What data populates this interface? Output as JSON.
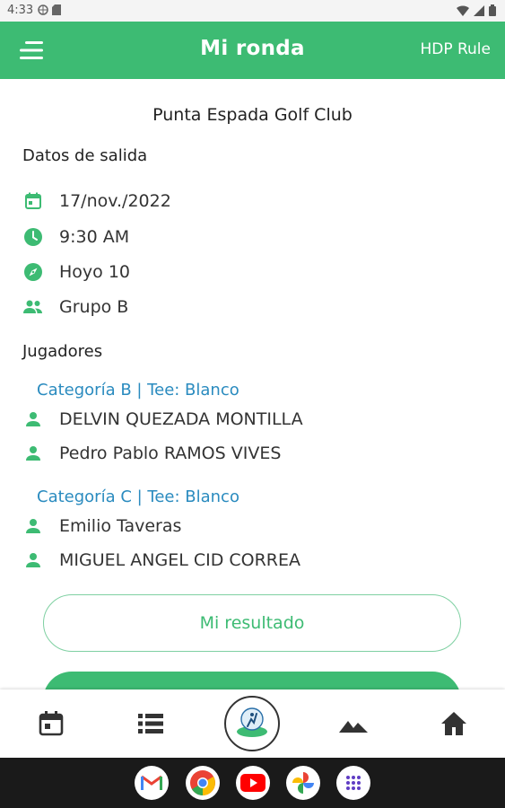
{
  "status_bar": {
    "time": "4:33"
  },
  "app_bar": {
    "title": "Mi ronda",
    "action_label": "HDP Rule"
  },
  "club_name": "Punta Espada Golf Club",
  "salida": {
    "section_title": "Datos de salida",
    "fecha": "17/nov./2022",
    "hora": "9:30 AM",
    "hoyo": "Hoyo 10",
    "grupo": "Grupo B"
  },
  "jugadores": {
    "section_title": "Jugadores",
    "groups": [
      {
        "category": "Categoría B | Tee: Blanco",
        "players": [
          "DELVIN QUEZADA MONTILLA",
          "Pedro Pablo RAMOS VIVES"
        ]
      },
      {
        "category": "Categoría C | Tee: Blanco",
        "players": [
          "Emilio Taveras",
          "MIGUEL ANGEL CID CORREA"
        ]
      }
    ]
  },
  "buttons": {
    "result_label": "Mi resultado"
  },
  "colors": {
    "primary": "#3dbb73",
    "category_blue": "#2a8bbf",
    "outline": "#7fd0a2"
  },
  "bottom_nav": [
    "calendar-icon",
    "list-icon",
    "club-logo",
    "mountain-icon",
    "home-icon"
  ],
  "dock_apps": [
    "gmail-icon",
    "chrome-icon",
    "youtube-icon",
    "photos-icon",
    "app-drawer-icon"
  ]
}
